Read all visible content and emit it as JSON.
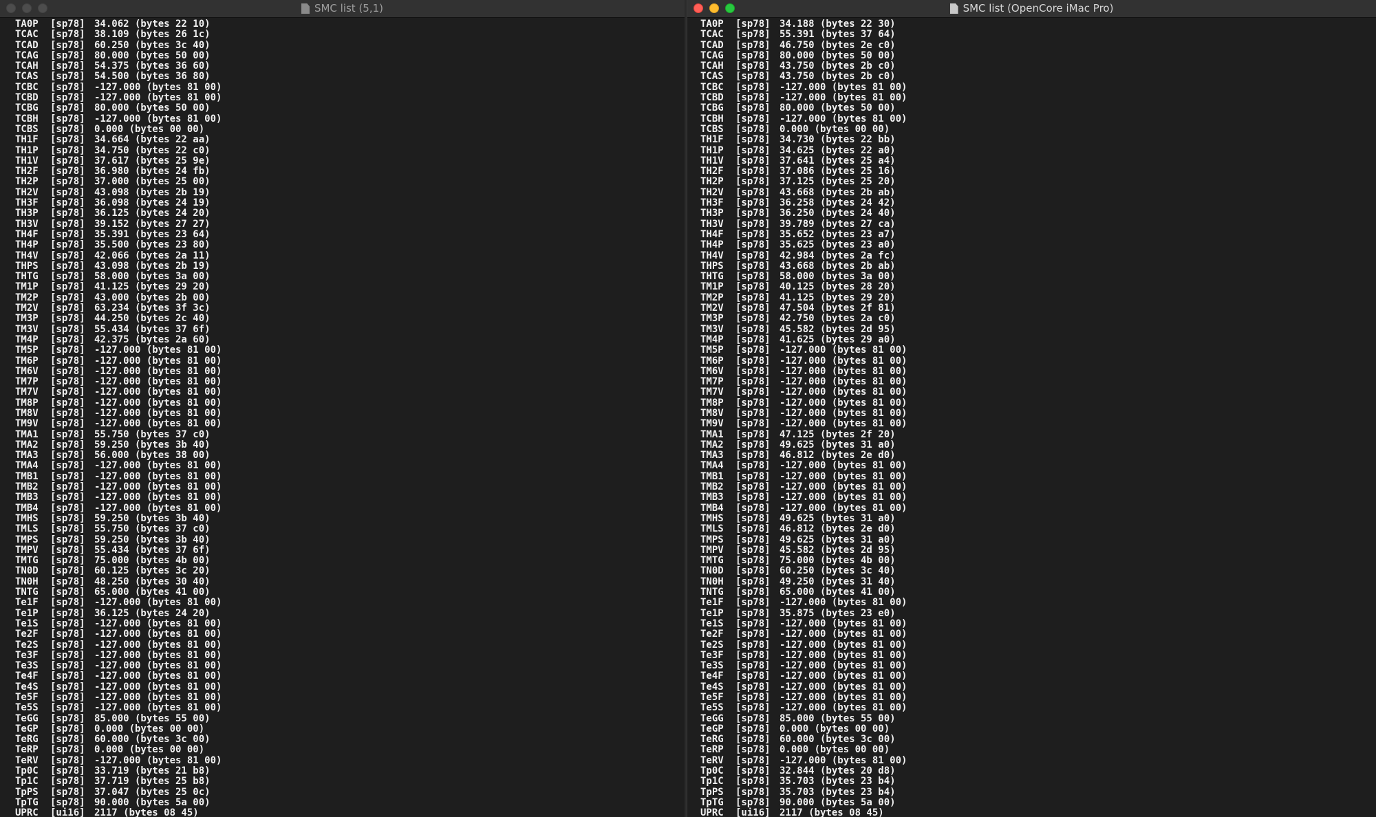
{
  "windows": [
    {
      "title": "SMC list (5,1)",
      "rows": [
        [
          "TA0P",
          "[sp78]",
          "34.062 (bytes 22 10)"
        ],
        [
          "TCAC",
          "[sp78]",
          "38.109 (bytes 26 1c)"
        ],
        [
          "TCAD",
          "[sp78]",
          "60.250 (bytes 3c 40)"
        ],
        [
          "TCAG",
          "[sp78]",
          "80.000 (bytes 50 00)"
        ],
        [
          "TCAH",
          "[sp78]",
          "54.375 (bytes 36 60)"
        ],
        [
          "TCAS",
          "[sp78]",
          "54.500 (bytes 36 80)"
        ],
        [
          "TCBC",
          "[sp78]",
          "-127.000 (bytes 81 00)"
        ],
        [
          "TCBD",
          "[sp78]",
          "-127.000 (bytes 81 00)"
        ],
        [
          "TCBG",
          "[sp78]",
          "80.000 (bytes 50 00)"
        ],
        [
          "TCBH",
          "[sp78]",
          "-127.000 (bytes 81 00)"
        ],
        [
          "TCBS",
          "[sp78]",
          "0.000 (bytes 00 00)"
        ],
        [
          "TH1F",
          "[sp78]",
          "34.664 (bytes 22 aa)"
        ],
        [
          "TH1P",
          "[sp78]",
          "34.750 (bytes 22 c0)"
        ],
        [
          "TH1V",
          "[sp78]",
          "37.617 (bytes 25 9e)"
        ],
        [
          "TH2F",
          "[sp78]",
          "36.980 (bytes 24 fb)"
        ],
        [
          "TH2P",
          "[sp78]",
          "37.000 (bytes 25 00)"
        ],
        [
          "TH2V",
          "[sp78]",
          "43.098 (bytes 2b 19)"
        ],
        [
          "TH3F",
          "[sp78]",
          "36.098 (bytes 24 19)"
        ],
        [
          "TH3P",
          "[sp78]",
          "36.125 (bytes 24 20)"
        ],
        [
          "TH3V",
          "[sp78]",
          "39.152 (bytes 27 27)"
        ],
        [
          "TH4F",
          "[sp78]",
          "35.391 (bytes 23 64)"
        ],
        [
          "TH4P",
          "[sp78]",
          "35.500 (bytes 23 80)"
        ],
        [
          "TH4V",
          "[sp78]",
          "42.066 (bytes 2a 11)"
        ],
        [
          "THPS",
          "[sp78]",
          "43.098 (bytes 2b 19)"
        ],
        [
          "THTG",
          "[sp78]",
          "58.000 (bytes 3a 00)"
        ],
        [
          "TM1P",
          "[sp78]",
          "41.125 (bytes 29 20)"
        ],
        [
          "TM2P",
          "[sp78]",
          "43.000 (bytes 2b 00)"
        ],
        [
          "TM2V",
          "[sp78]",
          "63.234 (bytes 3f 3c)"
        ],
        [
          "TM3P",
          "[sp78]",
          "44.250 (bytes 2c 40)"
        ],
        [
          "TM3V",
          "[sp78]",
          "55.434 (bytes 37 6f)"
        ],
        [
          "TM4P",
          "[sp78]",
          "42.375 (bytes 2a 60)"
        ],
        [
          "TM5P",
          "[sp78]",
          "-127.000 (bytes 81 00)"
        ],
        [
          "TM6P",
          "[sp78]",
          "-127.000 (bytes 81 00)"
        ],
        [
          "TM6V",
          "[sp78]",
          "-127.000 (bytes 81 00)"
        ],
        [
          "TM7P",
          "[sp78]",
          "-127.000 (bytes 81 00)"
        ],
        [
          "TM7V",
          "[sp78]",
          "-127.000 (bytes 81 00)"
        ],
        [
          "TM8P",
          "[sp78]",
          "-127.000 (bytes 81 00)"
        ],
        [
          "TM8V",
          "[sp78]",
          "-127.000 (bytes 81 00)"
        ],
        [
          "TM9V",
          "[sp78]",
          "-127.000 (bytes 81 00)"
        ],
        [
          "TMA1",
          "[sp78]",
          "55.750 (bytes 37 c0)"
        ],
        [
          "TMA2",
          "[sp78]",
          "59.250 (bytes 3b 40)"
        ],
        [
          "TMA3",
          "[sp78]",
          "56.000 (bytes 38 00)"
        ],
        [
          "TMA4",
          "[sp78]",
          "-127.000 (bytes 81 00)"
        ],
        [
          "TMB1",
          "[sp78]",
          "-127.000 (bytes 81 00)"
        ],
        [
          "TMB2",
          "[sp78]",
          "-127.000 (bytes 81 00)"
        ],
        [
          "TMB3",
          "[sp78]",
          "-127.000 (bytes 81 00)"
        ],
        [
          "TMB4",
          "[sp78]",
          "-127.000 (bytes 81 00)"
        ],
        [
          "TMHS",
          "[sp78]",
          "59.250 (bytes 3b 40)"
        ],
        [
          "TMLS",
          "[sp78]",
          "55.750 (bytes 37 c0)"
        ],
        [
          "TMPS",
          "[sp78]",
          "59.250 (bytes 3b 40)"
        ],
        [
          "TMPV",
          "[sp78]",
          "55.434 (bytes 37 6f)"
        ],
        [
          "TMTG",
          "[sp78]",
          "75.000 (bytes 4b 00)"
        ],
        [
          "TN0D",
          "[sp78]",
          "60.125 (bytes 3c 20)"
        ],
        [
          "TN0H",
          "[sp78]",
          "48.250 (bytes 30 40)"
        ],
        [
          "TNTG",
          "[sp78]",
          "65.000 (bytes 41 00)"
        ],
        [
          "Te1F",
          "[sp78]",
          "-127.000 (bytes 81 00)"
        ],
        [
          "Te1P",
          "[sp78]",
          "36.125 (bytes 24 20)"
        ],
        [
          "Te1S",
          "[sp78]",
          "-127.000 (bytes 81 00)"
        ],
        [
          "Te2F",
          "[sp78]",
          "-127.000 (bytes 81 00)"
        ],
        [
          "Te2S",
          "[sp78]",
          "-127.000 (bytes 81 00)"
        ],
        [
          "Te3F",
          "[sp78]",
          "-127.000 (bytes 81 00)"
        ],
        [
          "Te3S",
          "[sp78]",
          "-127.000 (bytes 81 00)"
        ],
        [
          "Te4F",
          "[sp78]",
          "-127.000 (bytes 81 00)"
        ],
        [
          "Te4S",
          "[sp78]",
          "-127.000 (bytes 81 00)"
        ],
        [
          "Te5F",
          "[sp78]",
          "-127.000 (bytes 81 00)"
        ],
        [
          "Te5S",
          "[sp78]",
          "-127.000 (bytes 81 00)"
        ],
        [
          "TeGG",
          "[sp78]",
          "85.000 (bytes 55 00)"
        ],
        [
          "TeGP",
          "[sp78]",
          "0.000 (bytes 00 00)"
        ],
        [
          "TeRG",
          "[sp78]",
          "60.000 (bytes 3c 00)"
        ],
        [
          "TeRP",
          "[sp78]",
          "0.000 (bytes 00 00)"
        ],
        [
          "TeRV",
          "[sp78]",
          "-127.000 (bytes 81 00)"
        ],
        [
          "Tp0C",
          "[sp78]",
          "33.719 (bytes 21 b8)"
        ],
        [
          "Tp1C",
          "[sp78]",
          "37.719 (bytes 25 b8)"
        ],
        [
          "TpPS",
          "[sp78]",
          "37.047 (bytes 25 0c)"
        ],
        [
          "TpTG",
          "[sp78]",
          "90.000 (bytes 5a 00)"
        ],
        [
          "UPRC",
          "[ui16]",
          "2117 (bytes 08 45)"
        ]
      ]
    },
    {
      "title": "SMC list (OpenCore iMac Pro)",
      "rows": [
        [
          "TA0P",
          "[sp78]",
          "34.188 (bytes 22 30)"
        ],
        [
          "TCAC",
          "[sp78]",
          "55.391 (bytes 37 64)"
        ],
        [
          "TCAD",
          "[sp78]",
          "46.750 (bytes 2e c0)"
        ],
        [
          "TCAG",
          "[sp78]",
          "80.000 (bytes 50 00)"
        ],
        [
          "TCAH",
          "[sp78]",
          "43.750 (bytes 2b c0)"
        ],
        [
          "TCAS",
          "[sp78]",
          "43.750 (bytes 2b c0)"
        ],
        [
          "TCBC",
          "[sp78]",
          "-127.000 (bytes 81 00)"
        ],
        [
          "TCBD",
          "[sp78]",
          "-127.000 (bytes 81 00)"
        ],
        [
          "TCBG",
          "[sp78]",
          "80.000 (bytes 50 00)"
        ],
        [
          "TCBH",
          "[sp78]",
          "-127.000 (bytes 81 00)"
        ],
        [
          "TCBS",
          "[sp78]",
          "0.000 (bytes 00 00)"
        ],
        [
          "TH1F",
          "[sp78]",
          "34.730 (bytes 22 bb)"
        ],
        [
          "TH1P",
          "[sp78]",
          "34.625 (bytes 22 a0)"
        ],
        [
          "TH1V",
          "[sp78]",
          "37.641 (bytes 25 a4)"
        ],
        [
          "TH2F",
          "[sp78]",
          "37.086 (bytes 25 16)"
        ],
        [
          "TH2P",
          "[sp78]",
          "37.125 (bytes 25 20)"
        ],
        [
          "TH2V",
          "[sp78]",
          "43.668 (bytes 2b ab)"
        ],
        [
          "TH3F",
          "[sp78]",
          "36.258 (bytes 24 42)"
        ],
        [
          "TH3P",
          "[sp78]",
          "36.250 (bytes 24 40)"
        ],
        [
          "TH3V",
          "[sp78]",
          "39.789 (bytes 27 ca)"
        ],
        [
          "TH4F",
          "[sp78]",
          "35.652 (bytes 23 a7)"
        ],
        [
          "TH4P",
          "[sp78]",
          "35.625 (bytes 23 a0)"
        ],
        [
          "TH4V",
          "[sp78]",
          "42.984 (bytes 2a fc)"
        ],
        [
          "THPS",
          "[sp78]",
          "43.668 (bytes 2b ab)"
        ],
        [
          "THTG",
          "[sp78]",
          "58.000 (bytes 3a 00)"
        ],
        [
          "TM1P",
          "[sp78]",
          "40.125 (bytes 28 20)"
        ],
        [
          "TM2P",
          "[sp78]",
          "41.125 (bytes 29 20)"
        ],
        [
          "TM2V",
          "[sp78]",
          "47.504 (bytes 2f 81)"
        ],
        [
          "TM3P",
          "[sp78]",
          "42.750 (bytes 2a c0)"
        ],
        [
          "TM3V",
          "[sp78]",
          "45.582 (bytes 2d 95)"
        ],
        [
          "TM4P",
          "[sp78]",
          "41.625 (bytes 29 a0)"
        ],
        [
          "TM5P",
          "[sp78]",
          "-127.000 (bytes 81 00)"
        ],
        [
          "TM6P",
          "[sp78]",
          "-127.000 (bytes 81 00)"
        ],
        [
          "TM6V",
          "[sp78]",
          "-127.000 (bytes 81 00)"
        ],
        [
          "TM7P",
          "[sp78]",
          "-127.000 (bytes 81 00)"
        ],
        [
          "TM7V",
          "[sp78]",
          "-127.000 (bytes 81 00)"
        ],
        [
          "TM8P",
          "[sp78]",
          "-127.000 (bytes 81 00)"
        ],
        [
          "TM8V",
          "[sp78]",
          "-127.000 (bytes 81 00)"
        ],
        [
          "TM9V",
          "[sp78]",
          "-127.000 (bytes 81 00)"
        ],
        [
          "TMA1",
          "[sp78]",
          "47.125 (bytes 2f 20)"
        ],
        [
          "TMA2",
          "[sp78]",
          "49.625 (bytes 31 a0)"
        ],
        [
          "TMA3",
          "[sp78]",
          "46.812 (bytes 2e d0)"
        ],
        [
          "TMA4",
          "[sp78]",
          "-127.000 (bytes 81 00)"
        ],
        [
          "TMB1",
          "[sp78]",
          "-127.000 (bytes 81 00)"
        ],
        [
          "TMB2",
          "[sp78]",
          "-127.000 (bytes 81 00)"
        ],
        [
          "TMB3",
          "[sp78]",
          "-127.000 (bytes 81 00)"
        ],
        [
          "TMB4",
          "[sp78]",
          "-127.000 (bytes 81 00)"
        ],
        [
          "TMHS",
          "[sp78]",
          "49.625 (bytes 31 a0)"
        ],
        [
          "TMLS",
          "[sp78]",
          "46.812 (bytes 2e d0)"
        ],
        [
          "TMPS",
          "[sp78]",
          "49.625 (bytes 31 a0)"
        ],
        [
          "TMPV",
          "[sp78]",
          "45.582 (bytes 2d 95)"
        ],
        [
          "TMTG",
          "[sp78]",
          "75.000 (bytes 4b 00)"
        ],
        [
          "TN0D",
          "[sp78]",
          "60.250 (bytes 3c 40)"
        ],
        [
          "TN0H",
          "[sp78]",
          "49.250 (bytes 31 40)"
        ],
        [
          "TNTG",
          "[sp78]",
          "65.000 (bytes 41 00)"
        ],
        [
          "Te1F",
          "[sp78]",
          "-127.000 (bytes 81 00)"
        ],
        [
          "Te1P",
          "[sp78]",
          "35.875 (bytes 23 e0)"
        ],
        [
          "Te1S",
          "[sp78]",
          "-127.000 (bytes 81 00)"
        ],
        [
          "Te2F",
          "[sp78]",
          "-127.000 (bytes 81 00)"
        ],
        [
          "Te2S",
          "[sp78]",
          "-127.000 (bytes 81 00)"
        ],
        [
          "Te3F",
          "[sp78]",
          "-127.000 (bytes 81 00)"
        ],
        [
          "Te3S",
          "[sp78]",
          "-127.000 (bytes 81 00)"
        ],
        [
          "Te4F",
          "[sp78]",
          "-127.000 (bytes 81 00)"
        ],
        [
          "Te4S",
          "[sp78]",
          "-127.000 (bytes 81 00)"
        ],
        [
          "Te5F",
          "[sp78]",
          "-127.000 (bytes 81 00)"
        ],
        [
          "Te5S",
          "[sp78]",
          "-127.000 (bytes 81 00)"
        ],
        [
          "TeGG",
          "[sp78]",
          "85.000 (bytes 55 00)"
        ],
        [
          "TeGP",
          "[sp78]",
          "0.000 (bytes 00 00)"
        ],
        [
          "TeRG",
          "[sp78]",
          "60.000 (bytes 3c 00)"
        ],
        [
          "TeRP",
          "[sp78]",
          "0.000 (bytes 00 00)"
        ],
        [
          "TeRV",
          "[sp78]",
          "-127.000 (bytes 81 00)"
        ],
        [
          "Tp0C",
          "[sp78]",
          "32.844 (bytes 20 d8)"
        ],
        [
          "Tp1C",
          "[sp78]",
          "35.703 (bytes 23 b4)"
        ],
        [
          "TpPS",
          "[sp78]",
          "35.703 (bytes 23 b4)"
        ],
        [
          "TpTG",
          "[sp78]",
          "90.000 (bytes 5a 00)"
        ],
        [
          "UPRC",
          "[ui16]",
          "2117 (bytes 08 45)"
        ]
      ]
    }
  ]
}
